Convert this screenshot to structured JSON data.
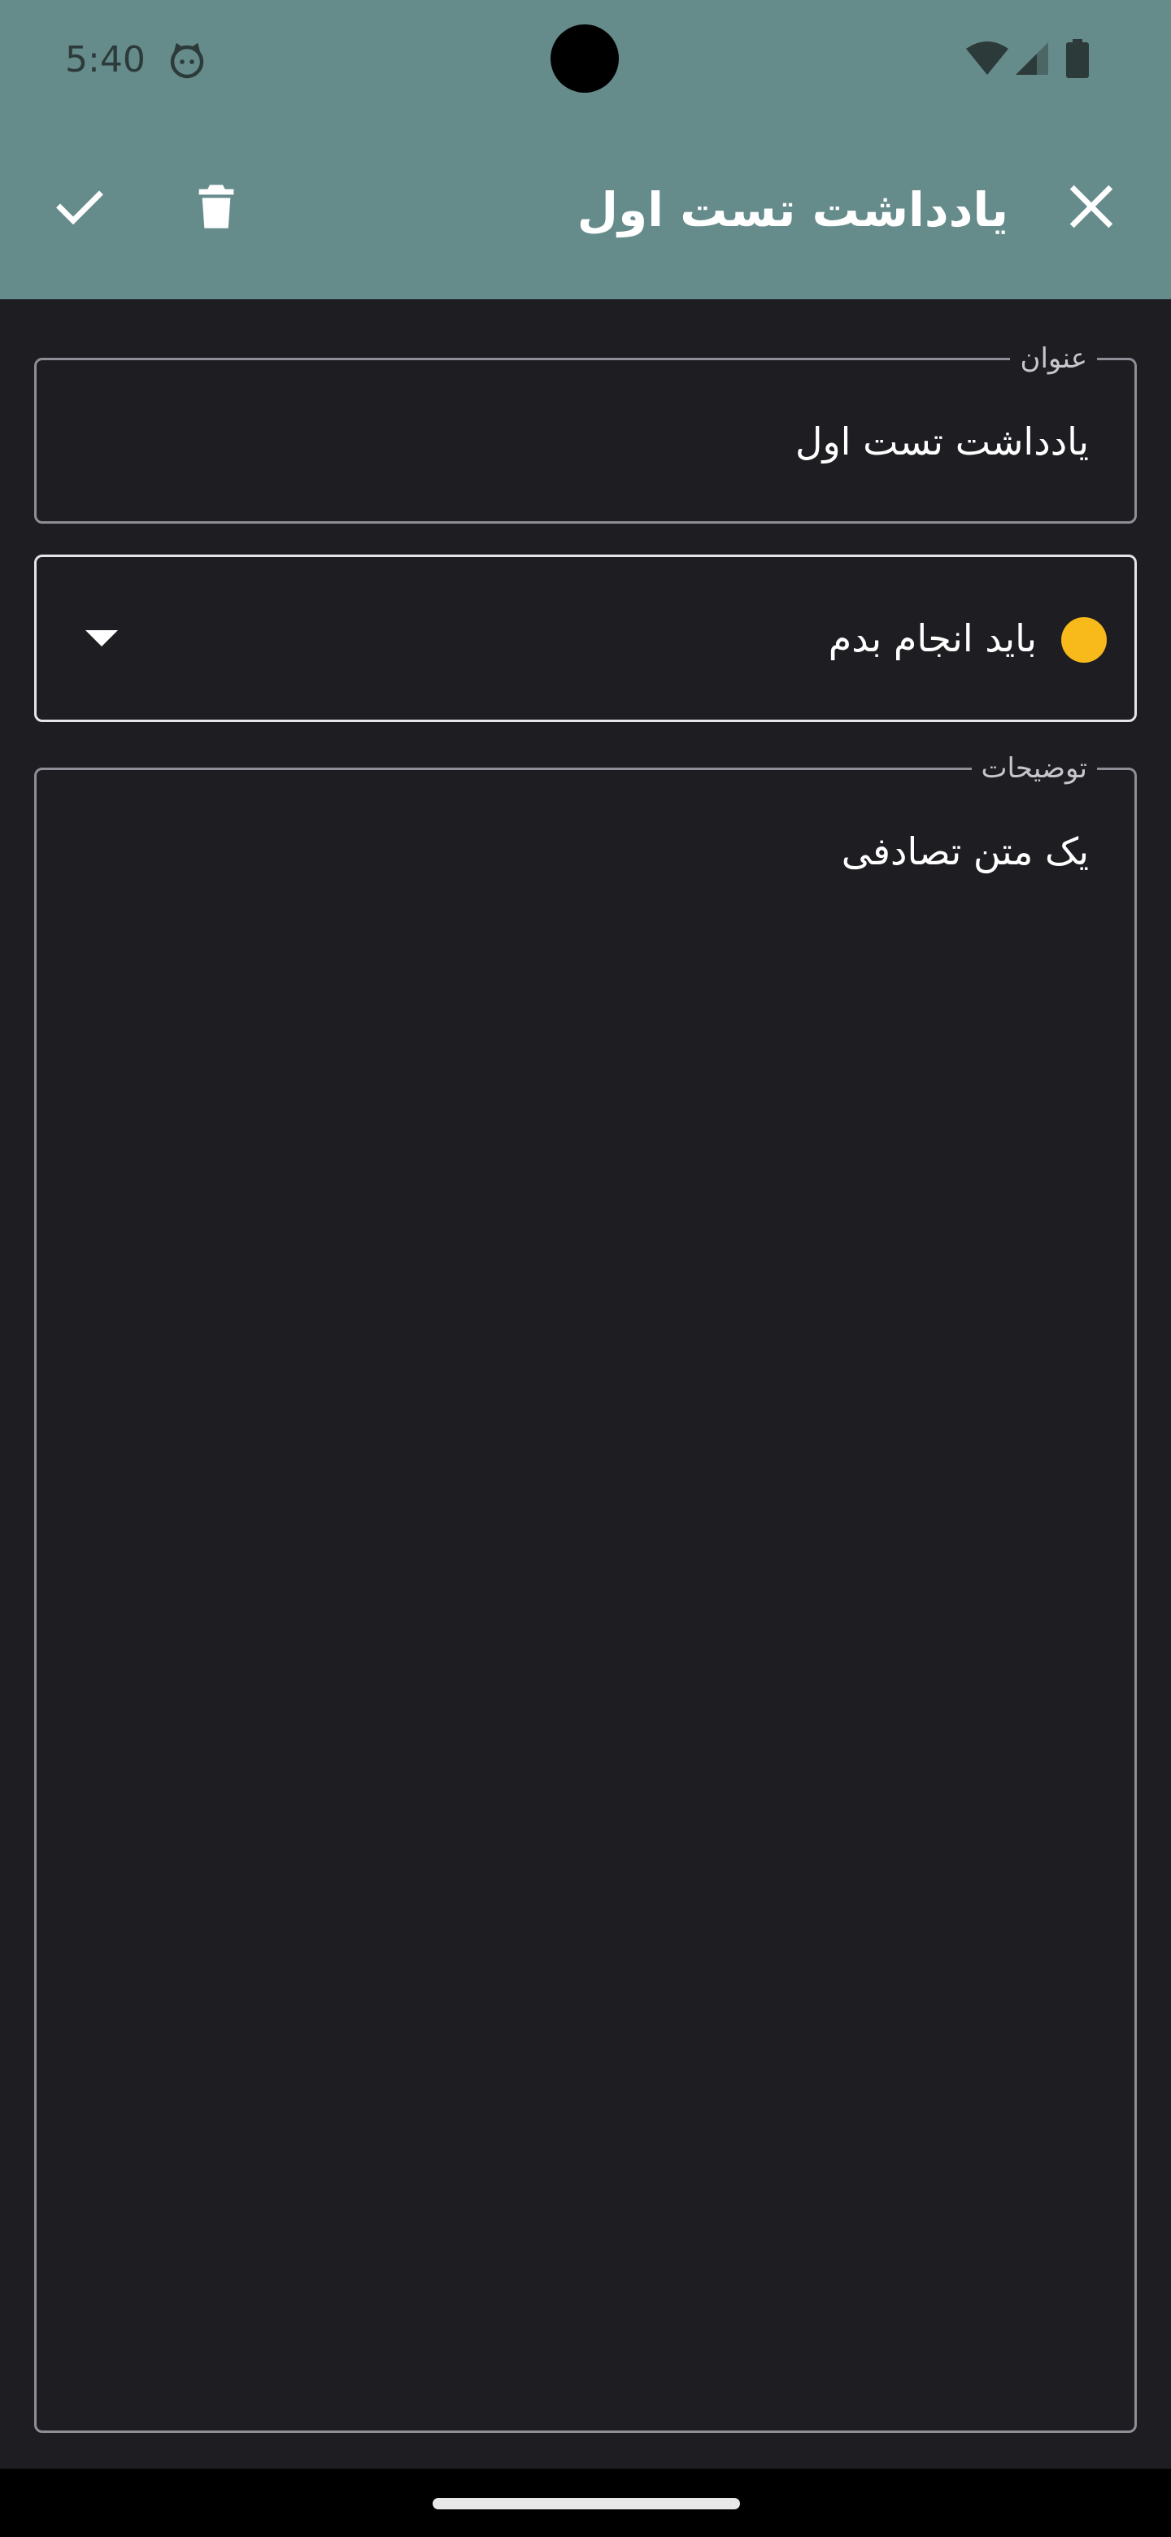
{
  "status_bar": {
    "time": "5:40",
    "icons": [
      "cat-face-icon",
      "wifi-icon",
      "signal-icon",
      "battery-icon"
    ]
  },
  "app_bar": {
    "title": "یادداشت تست اول",
    "actions": [
      "check-icon",
      "trash-icon",
      "close-icon"
    ],
    "background": "#668b8b"
  },
  "form": {
    "title_field": {
      "label": "عنوان",
      "value": "یادداشت تست اول"
    },
    "status_select": {
      "selected": "باید انجام بدم",
      "dot_color": "#f8b91b"
    },
    "description_field": {
      "label": "توضیحات",
      "value": "یک متن تصادفی"
    }
  },
  "colors": {
    "background": "#1e1d22",
    "text": "#ffffff",
    "outline": "#8e8e96"
  }
}
